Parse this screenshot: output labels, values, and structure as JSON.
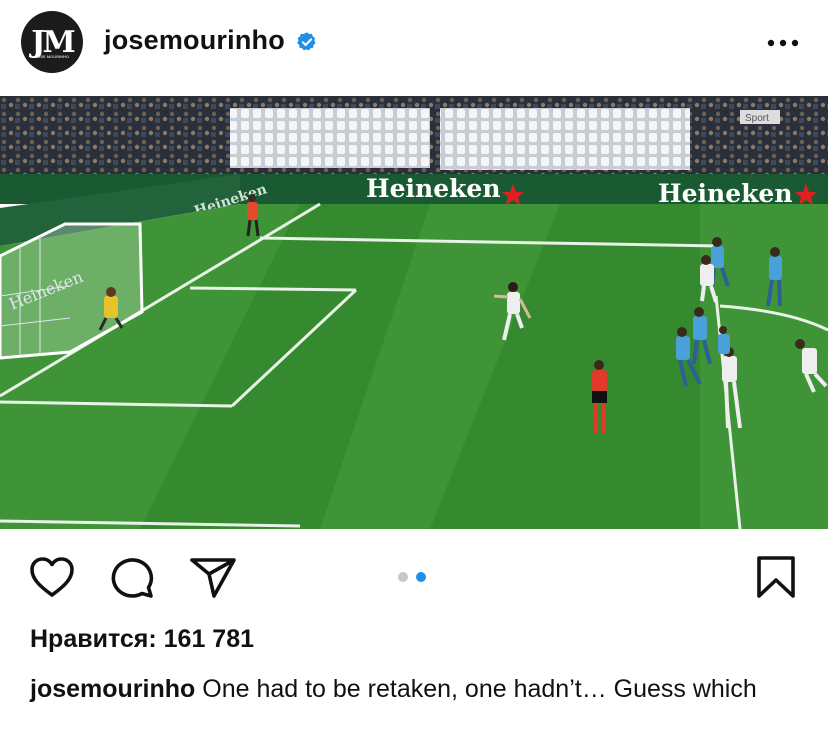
{
  "post": {
    "avatar_text": "JM",
    "avatar_small_text": "JOSE MOURINHO",
    "username": "josemourinho",
    "verified_icon": "verified-badge-icon",
    "more_icon": "more-options-icon"
  },
  "photo": {
    "ads": [
      "Heineken",
      "Heineken",
      "Heineken",
      "Heineken"
    ],
    "corner_text": "Sport"
  },
  "actions": {
    "like_icon": "heart-icon",
    "comment_icon": "comment-icon",
    "share_icon": "send-icon",
    "save_icon": "bookmark-icon",
    "carousel": {
      "total": 2,
      "active": 2
    }
  },
  "likes_text": "Нравится: 161 781",
  "caption": {
    "username": "josemourinho",
    "text": "One had to be retaken, one hadn’t… Guess which"
  },
  "colors": {
    "accent": "#1f8fe8",
    "text": "#111111",
    "pitch": "#3a8f33"
  }
}
